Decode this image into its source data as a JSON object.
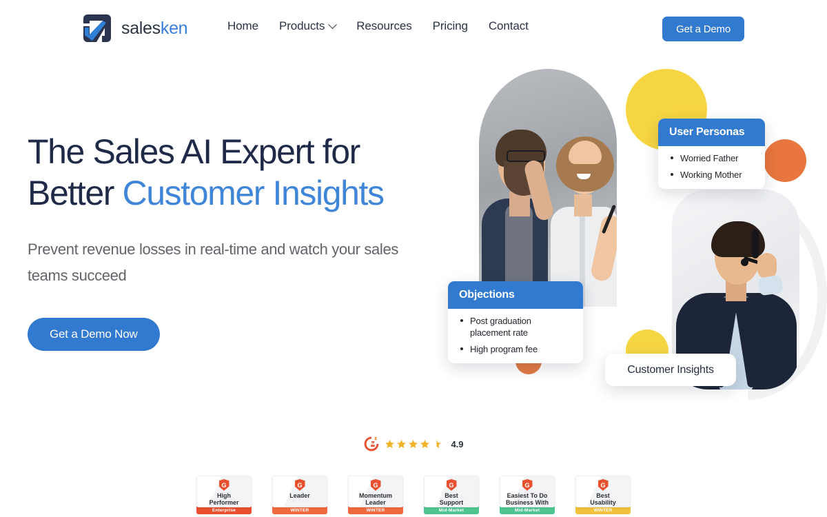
{
  "brand": {
    "logo_icon": "salesken-logo-icon",
    "name_part1": "sales",
    "name_part2": "ken"
  },
  "nav": {
    "items": [
      {
        "label": "Home",
        "has_chevron": false
      },
      {
        "label": "Products",
        "has_chevron": true
      },
      {
        "label": "Resources",
        "has_chevron": false
      },
      {
        "label": "Pricing",
        "has_chevron": false
      },
      {
        "label": "Contact",
        "has_chevron": false
      }
    ],
    "cta_label": "Get a Demo"
  },
  "hero": {
    "headline_line1": "The Sales AI Expert for",
    "headline_line2_plain": "Better ",
    "headline_line2_accent": "Customer Insights",
    "subheadline": "Prevent revenue losses in real-time and watch your sales teams succeed",
    "cta_label": "Get a Demo Now"
  },
  "cards": {
    "personas": {
      "title": "User Personas",
      "items": [
        "Worried Father",
        "Working Mother"
      ]
    },
    "objections": {
      "title": "Objections",
      "items": [
        "Post graduation placement rate",
        "High program fee"
      ]
    },
    "insights_pill": "Customer Insights"
  },
  "rating": {
    "logo_icon": "g2-logo-icon",
    "stars_full": 4,
    "stars_half": 1,
    "value": "4.9"
  },
  "badges": [
    {
      "title": "High\nPerformer",
      "ribbon": "Enterprise",
      "ribbon_color": "#e8502f",
      "shield_icon": "g2-shield-icon"
    },
    {
      "title": "Leader",
      "ribbon": "WINTER",
      "ribbon_color": "#f06a3e",
      "shield_icon": "g2-shield-icon"
    },
    {
      "title": "Momentum\nLeader",
      "ribbon": "WINTER",
      "ribbon_color": "#f06a3e",
      "shield_icon": "g2-shield-icon"
    },
    {
      "title": "Best\nSupport",
      "ribbon": "Mid-Market",
      "ribbon_color": "#4ec58f",
      "shield_icon": "g2-shield-icon"
    },
    {
      "title": "Easiest To Do\nBusiness With",
      "ribbon": "Mid-Market",
      "ribbon_color": "#4ec58f",
      "shield_icon": "g2-shield-icon"
    },
    {
      "title": "Best\nUsability",
      "ribbon": "WINTER",
      "ribbon_color": "#f2c23c",
      "shield_icon": "g2-shield-icon"
    }
  ],
  "colors": {
    "primary_blue": "#3279d0",
    "accent_blue": "#3f85d8",
    "headline_navy": "#1e2a47",
    "yellow": "#f6d543",
    "orange": "#e9763e",
    "g2_red": "#e8502f",
    "star_gold": "#f0b429"
  }
}
